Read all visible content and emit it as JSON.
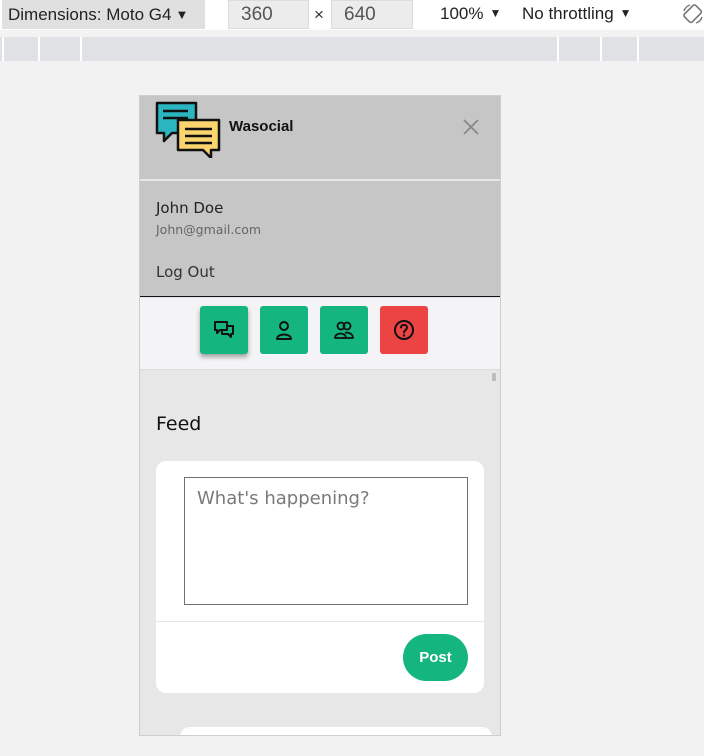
{
  "devtools": {
    "dimensions_label": "Dimensions: Moto G4",
    "width": "360",
    "times": "×",
    "height": "640",
    "zoom": "100%",
    "throttling": "No throttling",
    "caret": "▼"
  },
  "app": {
    "brand": "Wasocial",
    "user": {
      "name": "John Doe",
      "email": "John@gmail.com"
    },
    "logout_label": "Log Out",
    "nav": [
      {
        "icon": "chat-bubbles-icon",
        "color": "#14b57f"
      },
      {
        "icon": "user-icon",
        "color": "#14b57f"
      },
      {
        "icon": "users-icon",
        "color": "#14b57f"
      },
      {
        "icon": "help-circle-icon",
        "color": "#ec4343"
      }
    ],
    "feed": {
      "title": "Feed",
      "placeholder": "What's happening?",
      "post_label": "Post"
    }
  },
  "colors": {
    "accent": "#14b57f",
    "danger": "#ec4343",
    "sidebar_bg": "#c6c6c6"
  }
}
